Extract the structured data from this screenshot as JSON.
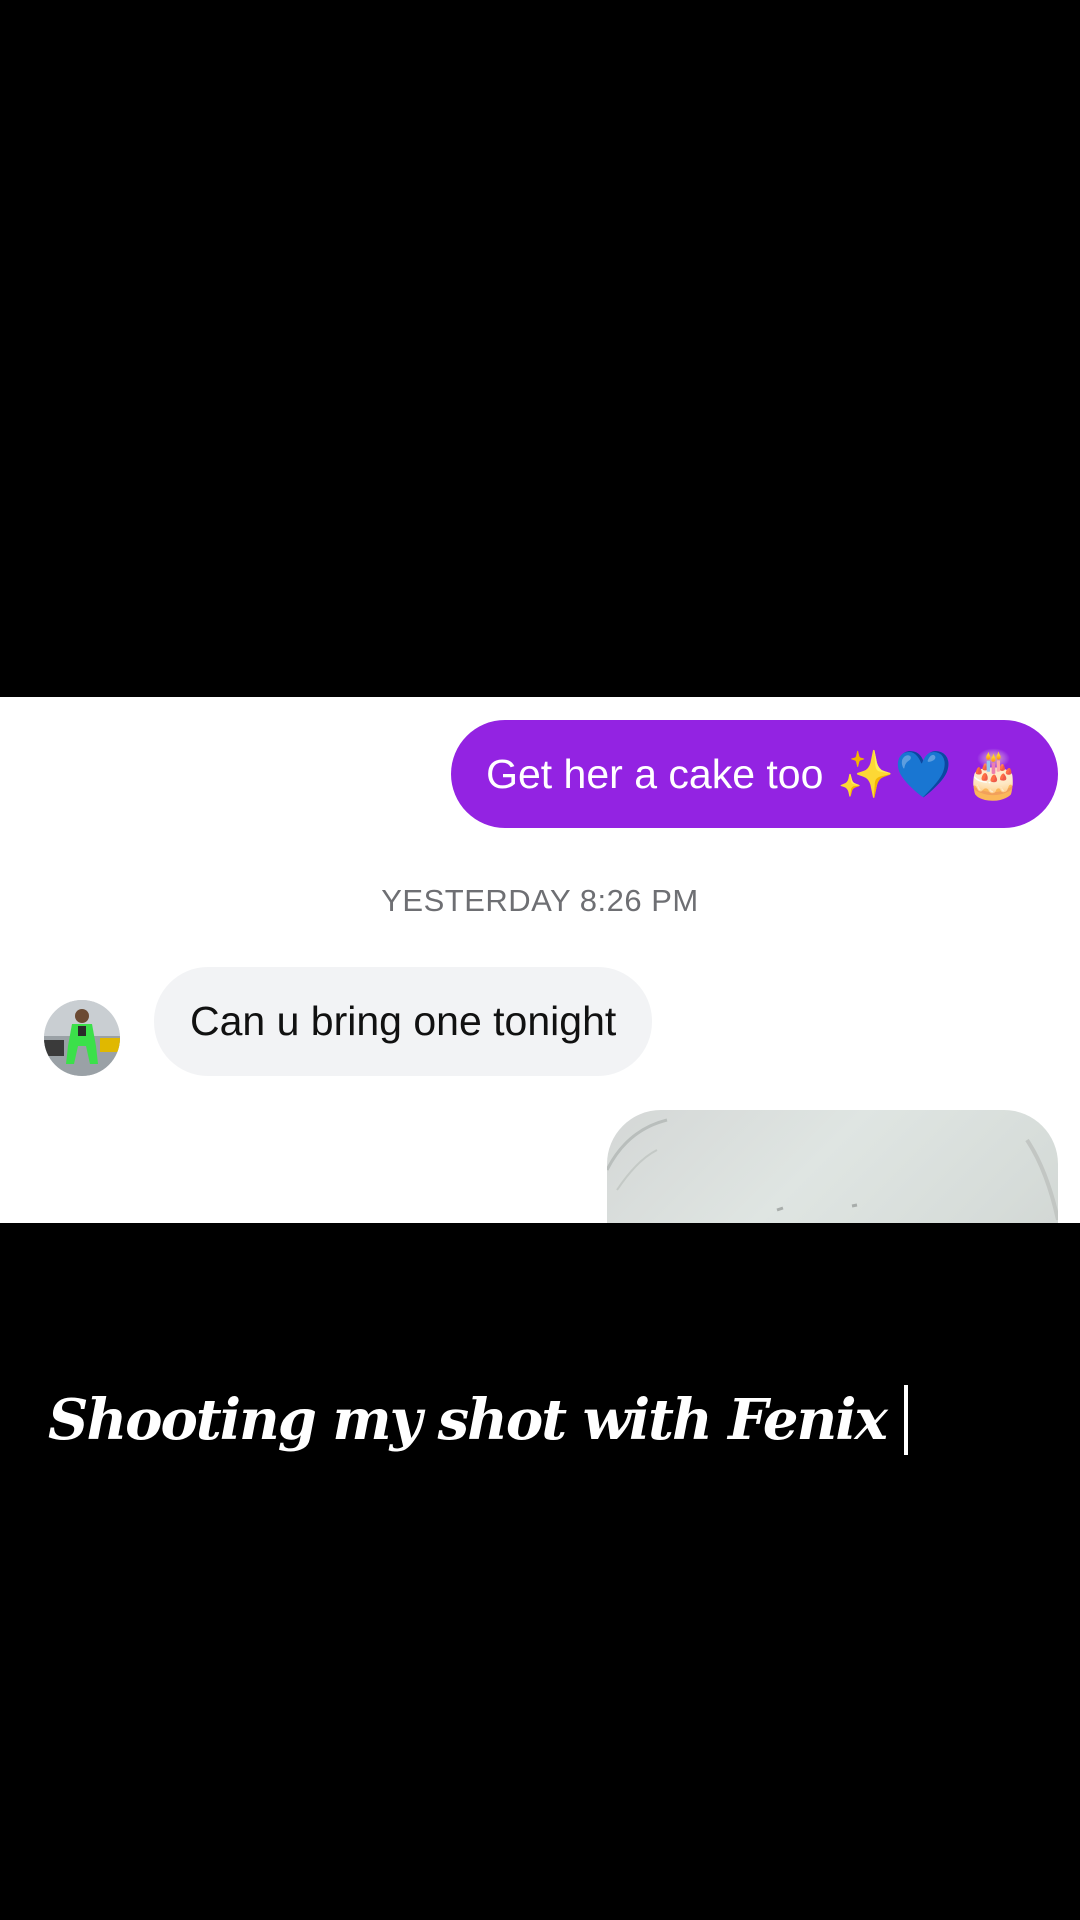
{
  "messages": {
    "outgoing": {
      "text": "Get her a cake too",
      "emoji": "✨💙 🎂"
    },
    "timestamp": "YESTERDAY 8:26 PM",
    "incoming": {
      "text": "Can u bring one tonight"
    }
  },
  "caption": {
    "text": "Shooting my shot with Fenix"
  },
  "colors": {
    "outgoing_bubble": "#9323e2",
    "incoming_bubble": "#f2f3f5",
    "timestamp": "#6e6f73"
  },
  "icons": {
    "avatar": "contact-avatar",
    "photo": "photo-attachment"
  }
}
